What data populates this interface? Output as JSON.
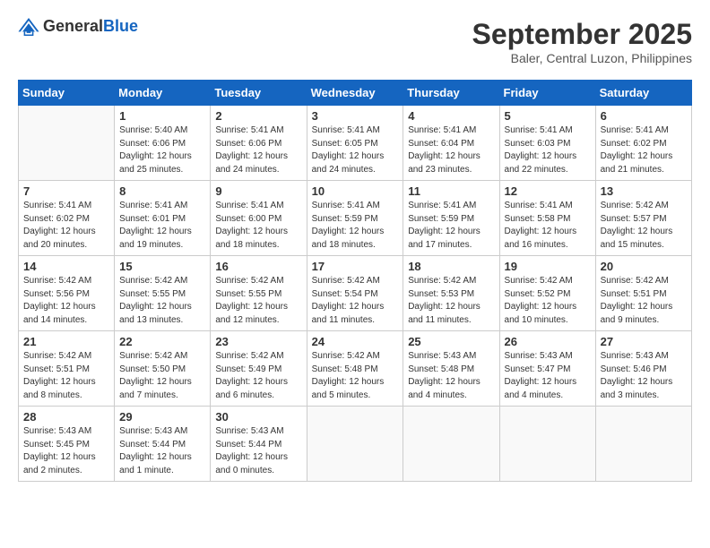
{
  "header": {
    "logo_general": "General",
    "logo_blue": "Blue",
    "month": "September 2025",
    "location": "Baler, Central Luzon, Philippines"
  },
  "weekdays": [
    "Sunday",
    "Monday",
    "Tuesday",
    "Wednesday",
    "Thursday",
    "Friday",
    "Saturday"
  ],
  "weeks": [
    [
      {
        "day": "",
        "info": ""
      },
      {
        "day": "1",
        "info": "Sunrise: 5:40 AM\nSunset: 6:06 PM\nDaylight: 12 hours\nand 25 minutes."
      },
      {
        "day": "2",
        "info": "Sunrise: 5:41 AM\nSunset: 6:06 PM\nDaylight: 12 hours\nand 24 minutes."
      },
      {
        "day": "3",
        "info": "Sunrise: 5:41 AM\nSunset: 6:05 PM\nDaylight: 12 hours\nand 24 minutes."
      },
      {
        "day": "4",
        "info": "Sunrise: 5:41 AM\nSunset: 6:04 PM\nDaylight: 12 hours\nand 23 minutes."
      },
      {
        "day": "5",
        "info": "Sunrise: 5:41 AM\nSunset: 6:03 PM\nDaylight: 12 hours\nand 22 minutes."
      },
      {
        "day": "6",
        "info": "Sunrise: 5:41 AM\nSunset: 6:02 PM\nDaylight: 12 hours\nand 21 minutes."
      }
    ],
    [
      {
        "day": "7",
        "info": "Sunrise: 5:41 AM\nSunset: 6:02 PM\nDaylight: 12 hours\nand 20 minutes."
      },
      {
        "day": "8",
        "info": "Sunrise: 5:41 AM\nSunset: 6:01 PM\nDaylight: 12 hours\nand 19 minutes."
      },
      {
        "day": "9",
        "info": "Sunrise: 5:41 AM\nSunset: 6:00 PM\nDaylight: 12 hours\nand 18 minutes."
      },
      {
        "day": "10",
        "info": "Sunrise: 5:41 AM\nSunset: 5:59 PM\nDaylight: 12 hours\nand 18 minutes."
      },
      {
        "day": "11",
        "info": "Sunrise: 5:41 AM\nSunset: 5:59 PM\nDaylight: 12 hours\nand 17 minutes."
      },
      {
        "day": "12",
        "info": "Sunrise: 5:41 AM\nSunset: 5:58 PM\nDaylight: 12 hours\nand 16 minutes."
      },
      {
        "day": "13",
        "info": "Sunrise: 5:42 AM\nSunset: 5:57 PM\nDaylight: 12 hours\nand 15 minutes."
      }
    ],
    [
      {
        "day": "14",
        "info": "Sunrise: 5:42 AM\nSunset: 5:56 PM\nDaylight: 12 hours\nand 14 minutes."
      },
      {
        "day": "15",
        "info": "Sunrise: 5:42 AM\nSunset: 5:55 PM\nDaylight: 12 hours\nand 13 minutes."
      },
      {
        "day": "16",
        "info": "Sunrise: 5:42 AM\nSunset: 5:55 PM\nDaylight: 12 hours\nand 12 minutes."
      },
      {
        "day": "17",
        "info": "Sunrise: 5:42 AM\nSunset: 5:54 PM\nDaylight: 12 hours\nand 11 minutes."
      },
      {
        "day": "18",
        "info": "Sunrise: 5:42 AM\nSunset: 5:53 PM\nDaylight: 12 hours\nand 11 minutes."
      },
      {
        "day": "19",
        "info": "Sunrise: 5:42 AM\nSunset: 5:52 PM\nDaylight: 12 hours\nand 10 minutes."
      },
      {
        "day": "20",
        "info": "Sunrise: 5:42 AM\nSunset: 5:51 PM\nDaylight: 12 hours\nand 9 minutes."
      }
    ],
    [
      {
        "day": "21",
        "info": "Sunrise: 5:42 AM\nSunset: 5:51 PM\nDaylight: 12 hours\nand 8 minutes."
      },
      {
        "day": "22",
        "info": "Sunrise: 5:42 AM\nSunset: 5:50 PM\nDaylight: 12 hours\nand 7 minutes."
      },
      {
        "day": "23",
        "info": "Sunrise: 5:42 AM\nSunset: 5:49 PM\nDaylight: 12 hours\nand 6 minutes."
      },
      {
        "day": "24",
        "info": "Sunrise: 5:42 AM\nSunset: 5:48 PM\nDaylight: 12 hours\nand 5 minutes."
      },
      {
        "day": "25",
        "info": "Sunrise: 5:43 AM\nSunset: 5:48 PM\nDaylight: 12 hours\nand 4 minutes."
      },
      {
        "day": "26",
        "info": "Sunrise: 5:43 AM\nSunset: 5:47 PM\nDaylight: 12 hours\nand 4 minutes."
      },
      {
        "day": "27",
        "info": "Sunrise: 5:43 AM\nSunset: 5:46 PM\nDaylight: 12 hours\nand 3 minutes."
      }
    ],
    [
      {
        "day": "28",
        "info": "Sunrise: 5:43 AM\nSunset: 5:45 PM\nDaylight: 12 hours\nand 2 minutes."
      },
      {
        "day": "29",
        "info": "Sunrise: 5:43 AM\nSunset: 5:44 PM\nDaylight: 12 hours\nand 1 minute."
      },
      {
        "day": "30",
        "info": "Sunrise: 5:43 AM\nSunset: 5:44 PM\nDaylight: 12 hours\nand 0 minutes."
      },
      {
        "day": "",
        "info": ""
      },
      {
        "day": "",
        "info": ""
      },
      {
        "day": "",
        "info": ""
      },
      {
        "day": "",
        "info": ""
      }
    ]
  ]
}
